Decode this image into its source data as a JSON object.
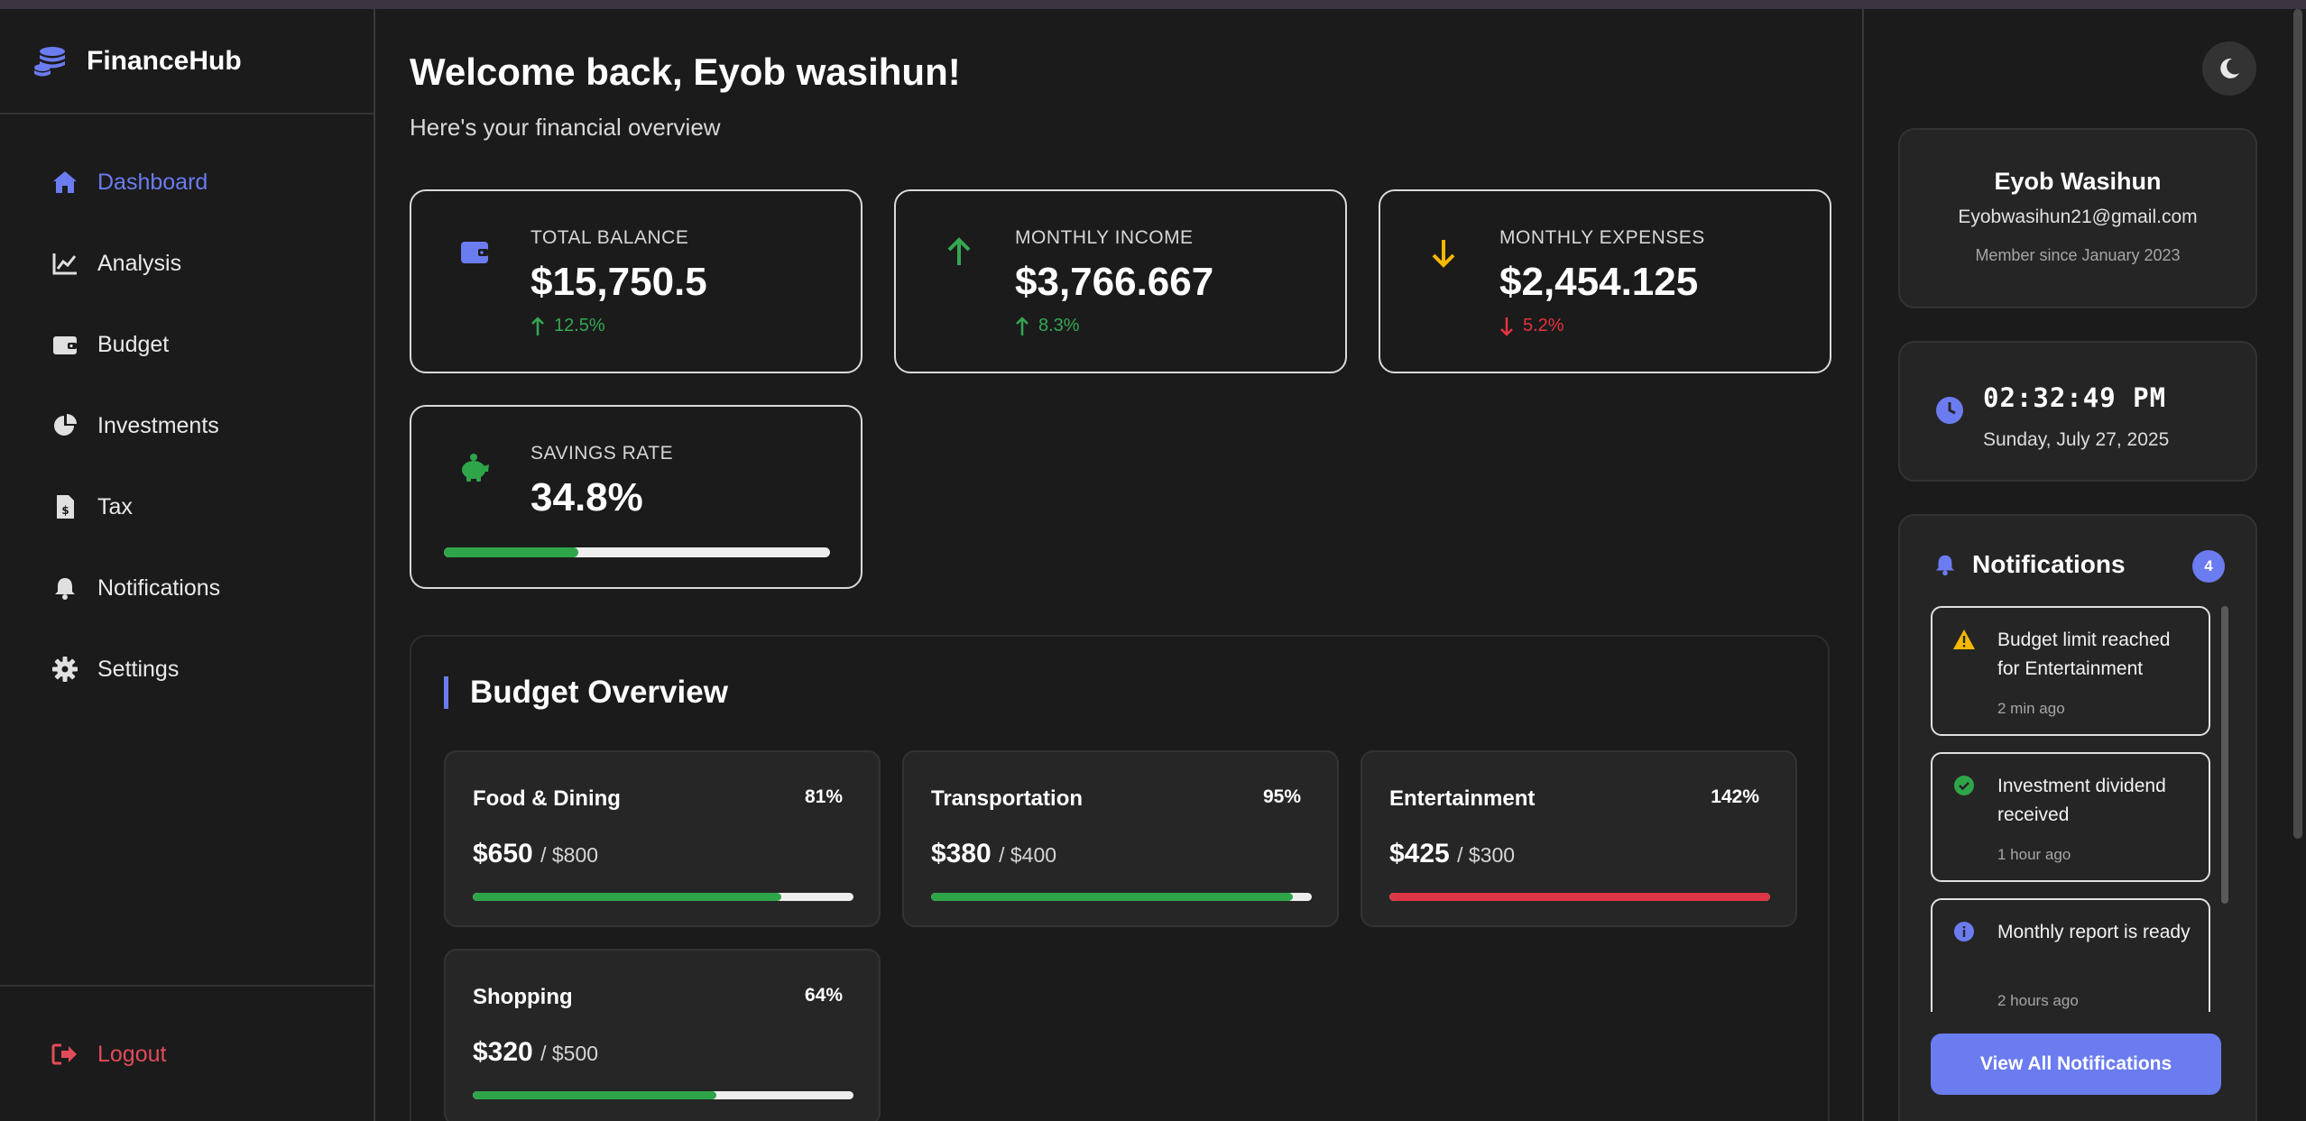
{
  "app": {
    "name": "FinanceHub"
  },
  "sidebar": {
    "items": [
      {
        "label": "Dashboard",
        "icon": "home-icon",
        "active": true
      },
      {
        "label": "Analysis",
        "icon": "chart-line-icon"
      },
      {
        "label": "Budget",
        "icon": "wallet-icon"
      },
      {
        "label": "Investments",
        "icon": "pie-chart-icon"
      },
      {
        "label": "Tax",
        "icon": "file-invoice-dollar-icon"
      },
      {
        "label": "Notifications",
        "icon": "bell-icon"
      },
      {
        "label": "Settings",
        "icon": "gear-icon"
      }
    ],
    "logout": "Logout"
  },
  "header": {
    "welcome": "Welcome back, Eyob wasihun!",
    "subtitle": "Here's your financial overview"
  },
  "stats": {
    "total_balance": {
      "label": "TOTAL BALANCE",
      "value": "$15,750.5",
      "trend": "12.5%",
      "direction": "up"
    },
    "monthly_income": {
      "label": "MONTHLY INCOME",
      "value": "$3,766.667",
      "trend": "8.3%",
      "direction": "up"
    },
    "monthly_expenses": {
      "label": "MONTHLY EXPENSES",
      "value": "$2,454.125",
      "trend": "5.2%",
      "direction": "down"
    },
    "savings_rate": {
      "label": "SAVINGS RATE",
      "value": "34.8%",
      "fraction": 0.348
    }
  },
  "budget": {
    "title": "Budget Overview",
    "items": [
      {
        "name": "Food & Dining",
        "percent": "81%",
        "spent": "$650",
        "limit": "/ $800",
        "fraction": 0.81,
        "color": "#2fa54a"
      },
      {
        "name": "Transportation",
        "percent": "95%",
        "spent": "$380",
        "limit": "/ $400",
        "fraction": 0.95,
        "color": "#2fa54a"
      },
      {
        "name": "Entertainment",
        "percent": "142%",
        "spent": "$425",
        "limit": "/ $300",
        "fraction": 1.0,
        "color": "#dc3545"
      },
      {
        "name": "Shopping",
        "percent": "64%",
        "spent": "$320",
        "limit": "/ $500",
        "fraction": 0.64,
        "color": "#2fa54a"
      }
    ]
  },
  "profile": {
    "name": "Eyob Wasihun",
    "email": "Eyobwasihun21@gmail.com",
    "member_since": "Member since January 2023"
  },
  "clock": {
    "time": "02:32:49 PM",
    "date": "Sunday, July 27, 2025"
  },
  "notifications": {
    "title": "Notifications",
    "count": "4",
    "items": [
      {
        "text": "Budget limit reached for Entertainment",
        "time": "2 min ago",
        "icon": "warning-icon"
      },
      {
        "text": "Investment dividend received",
        "time": "1 hour ago",
        "icon": "check-circle-icon"
      },
      {
        "text": "Monthly report is ready",
        "time": "2 hours ago",
        "icon": "info-icon"
      }
    ],
    "view_all": "View All Notifications"
  },
  "colors": {
    "accent": "#6b7cf0",
    "positive": "#34a853",
    "negative": "#e5333f",
    "warning": "#f5b800"
  }
}
